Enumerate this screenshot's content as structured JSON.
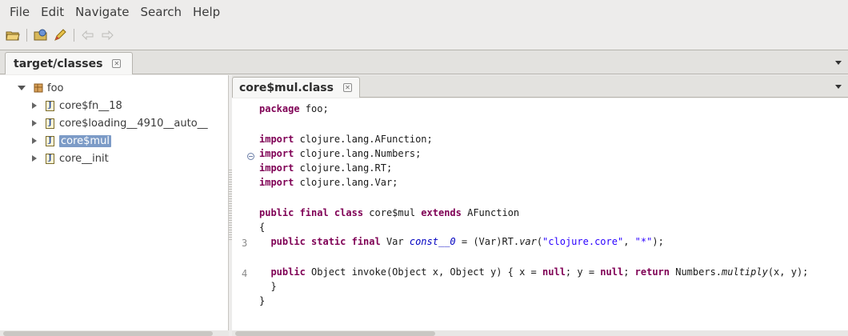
{
  "menubar": {
    "items": [
      "File",
      "Edit",
      "Navigate",
      "Search",
      "Help"
    ]
  },
  "toolbar": {
    "icons": [
      "open-folder-icon",
      "open-type-icon",
      "pencil-icon",
      "back-icon",
      "forward-icon"
    ]
  },
  "explorer": {
    "tab_label": "target/classes",
    "tree": {
      "package": "foo",
      "items": [
        {
          "label": "core$fn__18"
        },
        {
          "label": "core$loading__4910__auto__"
        },
        {
          "label": "core$mul",
          "selected": true
        },
        {
          "label": "core__init"
        }
      ]
    }
  },
  "editor": {
    "tab_label": "core$mul.class",
    "gutter": {
      "line_numbers": [
        "3",
        "4"
      ]
    },
    "code": {
      "package_kw": "package",
      "package_name": " foo;",
      "import_kw": "import",
      "imports": [
        " clojure.lang.AFunction;",
        " clojure.lang.Numbers;",
        " clojure.lang.RT;",
        " clojure.lang.Var;"
      ],
      "class_mods": "public final class",
      "class_name": " core$mul ",
      "extends_kw": "extends",
      "super_name": " AFunction",
      "open_brace": "{",
      "field_mods": "  public static final",
      "field_type": " Var ",
      "field_name": "const__0",
      "field_assign": " = (Var)RT.",
      "var_method": "var",
      "field_args_open": "(",
      "str1": "\"clojure.core\"",
      "comma": ", ",
      "str2": "\"*\"",
      "field_end": ");",
      "method_mod": "  public",
      "method_sig": " Object invoke(Object x, Object y) { x = ",
      "null_kw": "null",
      "y_assign": "; y = ",
      "return_sep": "; ",
      "return_kw": "return",
      "numbers_call": " Numbers.",
      "multiply": "multiply",
      "call_end": "(x, y);",
      "inner_close": "  }",
      "close_brace": "}"
    }
  }
}
